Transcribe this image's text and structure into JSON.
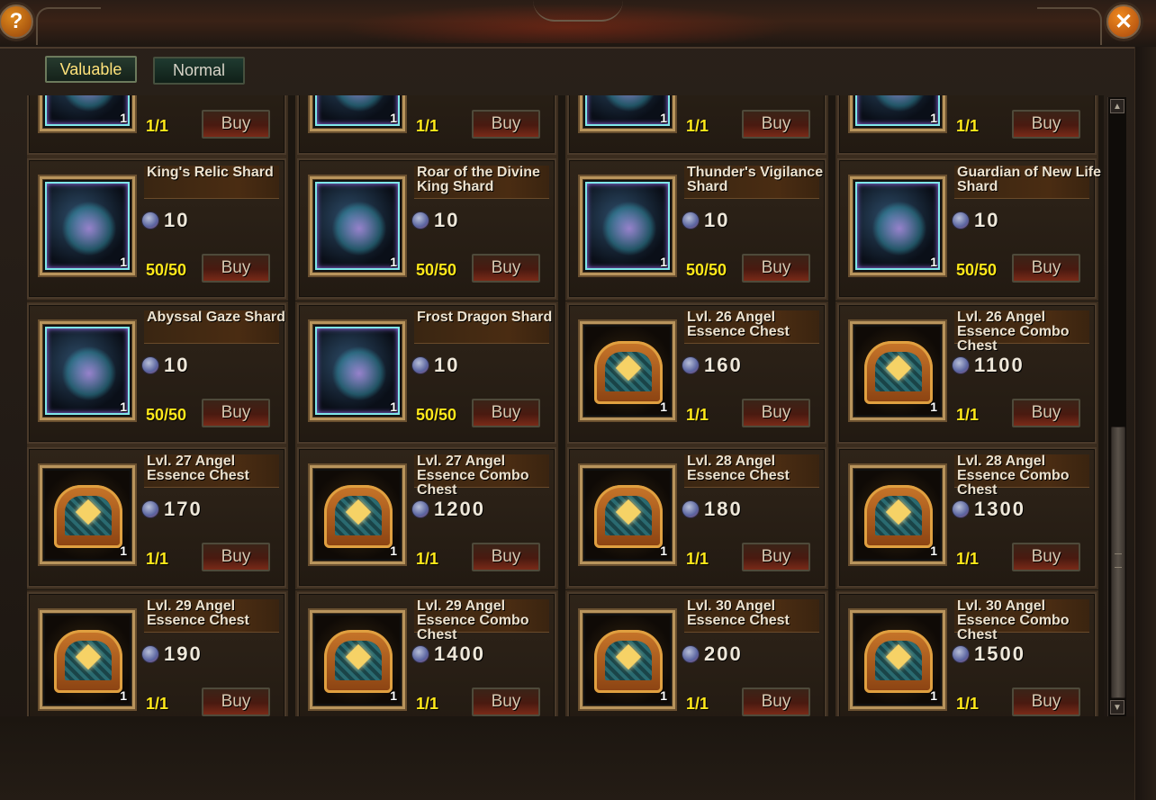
{
  "window": {
    "help_label": "?",
    "close_label": "✕",
    "help_icon": "question-icon",
    "close_icon": "close-icon"
  },
  "tabs": [
    {
      "label": "Valuable",
      "active": true
    },
    {
      "label": "Normal",
      "active": false
    }
  ],
  "colors": {
    "active_tab_text": "#ffe27a",
    "stock_text": "#ffe81a",
    "card_border": "#4a3a2a"
  },
  "items": [
    {
      "name": "",
      "price": "",
      "stock": "1/1",
      "buy_label": "Buy",
      "qty": "1",
      "icon": "shard"
    },
    {
      "name": "",
      "price": "",
      "stock": "1/1",
      "buy_label": "Buy",
      "qty": "1",
      "icon": "shard"
    },
    {
      "name": "",
      "price": "",
      "stock": "1/1",
      "buy_label": "Buy",
      "qty": "1",
      "icon": "shard"
    },
    {
      "name": "",
      "price": "",
      "stock": "1/1",
      "buy_label": "Buy",
      "qty": "1",
      "icon": "shard"
    },
    {
      "name": "King's Relic Shard",
      "price": "10",
      "stock": "50/50",
      "buy_label": "Buy",
      "qty": "1",
      "icon": "shard"
    },
    {
      "name": "Roar of the Divine King Shard",
      "price": "10",
      "stock": "50/50",
      "buy_label": "Buy",
      "qty": "1",
      "icon": "shard"
    },
    {
      "name": "Thunder's Vigilance Shard",
      "price": "10",
      "stock": "50/50",
      "buy_label": "Buy",
      "qty": "1",
      "icon": "shard"
    },
    {
      "name": "Guardian of New Life Shard",
      "price": "10",
      "stock": "50/50",
      "buy_label": "Buy",
      "qty": "1",
      "icon": "shard"
    },
    {
      "name": "Abyssal Gaze Shard",
      "price": "10",
      "stock": "50/50",
      "buy_label": "Buy",
      "qty": "1",
      "icon": "shard"
    },
    {
      "name": "Frost Dragon Shard",
      "price": "10",
      "stock": "50/50",
      "buy_label": "Buy",
      "qty": "1",
      "icon": "shard"
    },
    {
      "name": "Lvl. 26 Angel Essence Chest",
      "price": "160",
      "stock": "1/1",
      "buy_label": "Buy",
      "qty": "1",
      "icon": "chest"
    },
    {
      "name": "Lvl. 26 Angel Essence Combo Chest",
      "price": "1100",
      "stock": "1/1",
      "buy_label": "Buy",
      "qty": "1",
      "icon": "chest"
    },
    {
      "name": "Lvl. 27 Angel Essence Chest",
      "price": "170",
      "stock": "1/1",
      "buy_label": "Buy",
      "qty": "1",
      "icon": "chest"
    },
    {
      "name": "Lvl. 27 Angel Essence Combo Chest",
      "price": "1200",
      "stock": "1/1",
      "buy_label": "Buy",
      "qty": "1",
      "icon": "chest"
    },
    {
      "name": "Lvl. 28 Angel Essence Chest",
      "price": "180",
      "stock": "1/1",
      "buy_label": "Buy",
      "qty": "1",
      "icon": "chest"
    },
    {
      "name": "Lvl. 28 Angel Essence Combo Chest",
      "price": "1300",
      "stock": "1/1",
      "buy_label": "Buy",
      "qty": "1",
      "icon": "chest"
    },
    {
      "name": "Lvl. 29 Angel Essence Chest",
      "price": "190",
      "stock": "1/1",
      "buy_label": "Buy",
      "qty": "1",
      "icon": "chest"
    },
    {
      "name": "Lvl. 29 Angel Essence Combo Chest",
      "price": "1400",
      "stock": "1/1",
      "buy_label": "Buy",
      "qty": "1",
      "icon": "chest"
    },
    {
      "name": "Lvl. 30 Angel Essence Chest",
      "price": "200",
      "stock": "1/1",
      "buy_label": "Buy",
      "qty": "1",
      "icon": "chest"
    },
    {
      "name": "Lvl. 30 Angel Essence Combo Chest",
      "price": "1500",
      "stock": "1/1",
      "buy_label": "Buy",
      "qty": "1",
      "icon": "chest"
    }
  ],
  "scrollbar": {
    "up_label": "▲",
    "down_label": "▼"
  }
}
